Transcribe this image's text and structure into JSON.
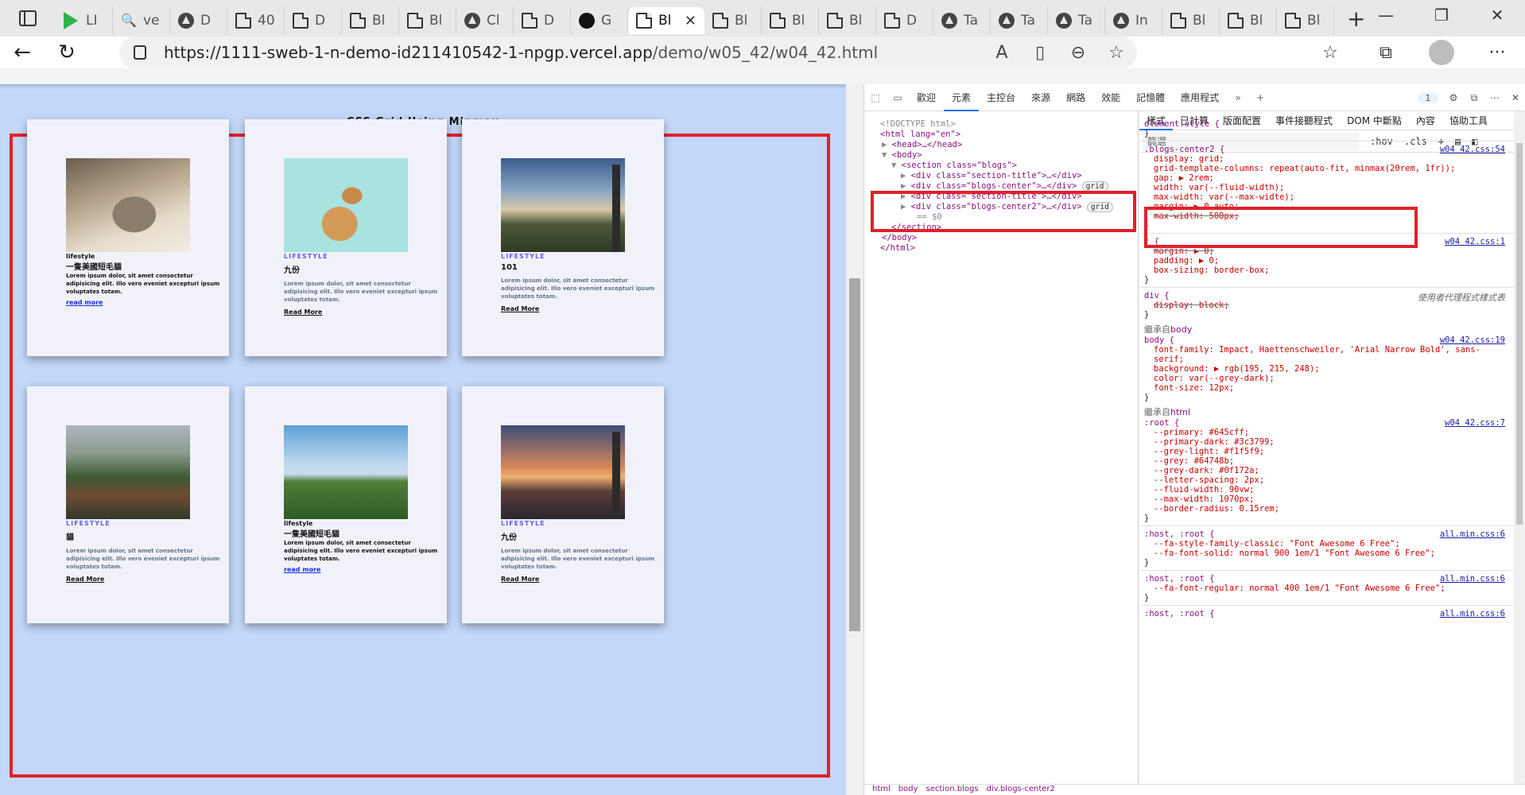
{
  "browser": {
    "tabs": [
      {
        "label": "LI",
        "icon": "play-icon"
      },
      {
        "label": "ve",
        "icon": "search-icon"
      },
      {
        "label": "D",
        "icon": "triangle-icon"
      },
      {
        "label": "40",
        "icon": "doc-icon"
      },
      {
        "label": "D",
        "icon": "doc-icon"
      },
      {
        "label": "Bl",
        "icon": "doc-icon"
      },
      {
        "label": "Bl",
        "icon": "doc-icon"
      },
      {
        "label": "Cl",
        "icon": "triangle-icon"
      },
      {
        "label": "D",
        "icon": "doc-icon"
      },
      {
        "label": "G",
        "icon": "github-icon"
      },
      {
        "label": "Bl",
        "icon": "doc-icon",
        "active": true
      },
      {
        "label": "Bl",
        "icon": "doc-icon"
      },
      {
        "label": "Bl",
        "icon": "doc-icon"
      },
      {
        "label": "Bl",
        "icon": "doc-icon"
      },
      {
        "label": "D",
        "icon": "doc-icon"
      },
      {
        "label": "Ta",
        "icon": "triangle-icon"
      },
      {
        "label": "Ta",
        "icon": "triangle-icon"
      },
      {
        "label": "Ta",
        "icon": "triangle-icon"
      },
      {
        "label": "In",
        "icon": "triangle-icon"
      },
      {
        "label": "Bl",
        "icon": "doc-icon"
      },
      {
        "label": "Bl",
        "icon": "doc-icon"
      },
      {
        "label": "Bl",
        "icon": "doc-icon"
      }
    ],
    "url_host": "https://1111-sweb-1-n-demo-id211410542-1-npgp.vercel.app",
    "url_path": "/demo/w05_42/w04_42.html"
  },
  "page": {
    "section_title": "CSS Grid Using Minmax",
    "cards": [
      {
        "category": "lifestyle",
        "title": "一隻美國短毛貓",
        "text": "Lorem ipsum dolor, sit amet consectetur adipisicing elit. Illo vero eveniet excepturi ipsum voluptates totam.",
        "link": "read more",
        "plain": true,
        "image": "cat1"
      },
      {
        "category": "LIFESTYLE",
        "title": "九份",
        "text": "Lorem ipsum dolor, sit amet consectetur adipisicing elit. Illo vero eveniet excepturi ipsum voluptates totam.",
        "link": "Read More",
        "plain": false,
        "image": "cat2"
      },
      {
        "category": "LIFESTYLE",
        "title": "101",
        "text": "Lorem ipsum dolor, sit amet consectetur adipisicing elit. Illo vero eveniet excepturi ipsum voluptates totam.",
        "link": "Read More",
        "plain": false,
        "image": "city1"
      },
      {
        "category": "LIFESTYLE",
        "title": "貓",
        "text": "Lorem ipsum dolor, sit amet consectetur adipisicing elit. Illo vero eveniet excepturi ipsum voluptates totam.",
        "link": "Read More",
        "plain": false,
        "image": "house"
      },
      {
        "category": "lifestyle",
        "title": "一隻美國短毛貓",
        "text": "Lorem ipsum dolor, sit amet consectetur adipisicing elit. Illo vero eveniet excepturi ipsum voluptates totam.",
        "link": "read more",
        "plain": true,
        "image": "hill"
      },
      {
        "category": "LIFESTYLE",
        "title": "九份",
        "text": "Lorem ipsum dolor, sit amet consectetur adipisicing elit. Illo vero eveniet excepturi ipsum voluptates totam.",
        "link": "Read More",
        "plain": false,
        "image": "city2"
      }
    ]
  },
  "devtools": {
    "tabs": [
      "歡迎",
      "元素",
      "主控台",
      "來源",
      "網路",
      "效能",
      "記憶體",
      "應用程式"
    ],
    "issues_badge": "1",
    "dom": {
      "doctype": "<!DOCTYPE html>",
      "html_open": "<html lang=\"en\">",
      "head": "<head>…</head>",
      "body_open": "<body>",
      "section_open": "<section class=\"blogs\">",
      "div1": "<div class=\"section-title\">…</div>",
      "div2": "<div class=\"blogs-center\">…</div>",
      "div3": "<div class=\"section-title\">…</div>",
      "div4": "<div class=\"blogs-center2\">…</div>",
      "grid_tag": "grid",
      "dollar0": "== $0",
      "section_close": "</section>",
      "body_close": "</body>",
      "html_close": "</html>"
    },
    "breadcrumb": [
      "html",
      "body",
      "section.blogs",
      "div.blogs-center2"
    ],
    "styles_tabs": [
      "樣式",
      "已計算",
      "版面配置",
      "事件接聽程式",
      "DOM 中斷點",
      "內容",
      "協助工具"
    ],
    "filter_placeholder": "篩選",
    "hov": ":hov",
    "cls": ".cls",
    "rules": {
      "element_style": "element.style {",
      "close": "}",
      "blogs_sel": ".blogs-center2 {",
      "blogs_src": "w04 42.css:54",
      "blogs_props": [
        "display: grid;",
        "grid-template-columns: repeat(auto-fit, minmax(20rem, 1fr));",
        "gap: ▶ 2rem;",
        "width: var(--fluid-width);",
        "max-width: var(--max-widte);",
        "margin: ▶ 0 auto;",
        "max-width: 500px;"
      ],
      "star_sel": "* {",
      "star_src": "w04 42.css:1",
      "star_props": [
        "margin: ▶ 0;",
        "padding: ▶ 0;",
        "box-sizing: border-box;"
      ],
      "div_sel": "div {",
      "div_src": "使用者代理程式樣式表",
      "div_props": [
        "display: block;"
      ],
      "inherit_body": "繼承自",
      "inherit_body_tag": "body",
      "body_sel": "body {",
      "body_src": "w04 42.css:19",
      "body_props": [
        "font-family: Impact, Haettenschweiler, 'Arial Narrow Bold', sans-",
        "serif;",
        "background: ▶ rgb(195, 215, 248);",
        "color: var(--grey-dark);",
        "font-size: 12px;"
      ],
      "inherit_html": "繼承自",
      "inherit_html_tag": "html",
      "root_sel": ":root {",
      "root_src": "w04 42.css:7",
      "root_props": [
        "--primary: #645cff;",
        "--primary-dark: #3c3799;",
        "--grey-light: #f1f5f9;",
        "--grey: #64748b;",
        "--grey-dark: #0f172a;",
        "--letter-spacing: 2px;",
        "--fluid-width: 90vw;",
        "--max-width: 1070px;",
        "--border-radius: 0.15rem;"
      ],
      "host1_sel": ":host, :root {",
      "host1_src": "all.min.css:6",
      "host1_props": [
        "--fa-style-family-classic: \"Font Awesome 6 Free\";",
        "--fa-font-solid: normal 900 1em/1 \"Font Awesome 6 Free\";"
      ],
      "host2_sel": ":host, :root {",
      "host2_src": "all.min.css:6",
      "host2_props": [
        "--fa-font-regular: normal 400 1em/1 \"Font Awesome 6 Free\";"
      ],
      "host3_sel": ":host, :root {",
      "host3_src": "all.min.css:6"
    },
    "colors": {
      "primary": "#645cff",
      "primary_dark": "#3c3799",
      "grey_light": "#f1f5f9",
      "grey": "#64748b",
      "grey_dark": "#0f172a",
      "page_bg": "#c3d7f8",
      "highlight": "#e0212b"
    }
  }
}
